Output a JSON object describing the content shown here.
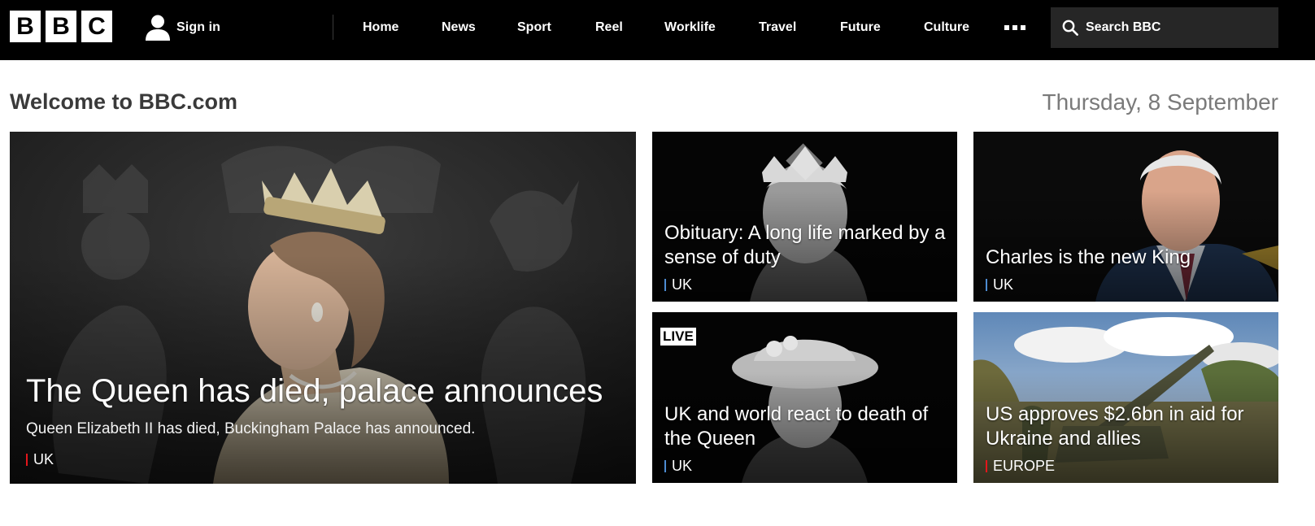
{
  "header": {
    "logo_letters": [
      "B",
      "B",
      "C"
    ],
    "sign_in": "Sign in",
    "nav": [
      "Home",
      "News",
      "Sport",
      "Reel",
      "Worklife",
      "Travel",
      "Future",
      "Culture"
    ],
    "search_placeholder": "Search BBC",
    "icons": {
      "user": "user-icon",
      "more": "more-icon",
      "search": "search-icon"
    }
  },
  "page": {
    "welcome": "Welcome to BBC.com",
    "date": "Thursday, 8 September"
  },
  "hero": {
    "title": "The Queen has died, palace announces",
    "summary": "Queen Elizabeth II has died, Buckingham Palace has announced.",
    "tag": "UK"
  },
  "stories": [
    {
      "title": "Obituary: A long life marked by a sense of duty",
      "tag": "UK"
    },
    {
      "title": "Charles is the new King",
      "tag": "UK"
    },
    {
      "title": "UK and world react to death of the Queen",
      "tag": "UK",
      "badge": "LIVE"
    },
    {
      "title": "US approves $2.6bn in aid for Ukraine and allies",
      "tag": "EUROPE"
    }
  ],
  "colors": {
    "topbar": "#000000",
    "tag_uk_bar_hero": "#e3161b",
    "tag_uk_bar": "#4d8bd1",
    "tag_europe_bar": "#e3161b"
  }
}
